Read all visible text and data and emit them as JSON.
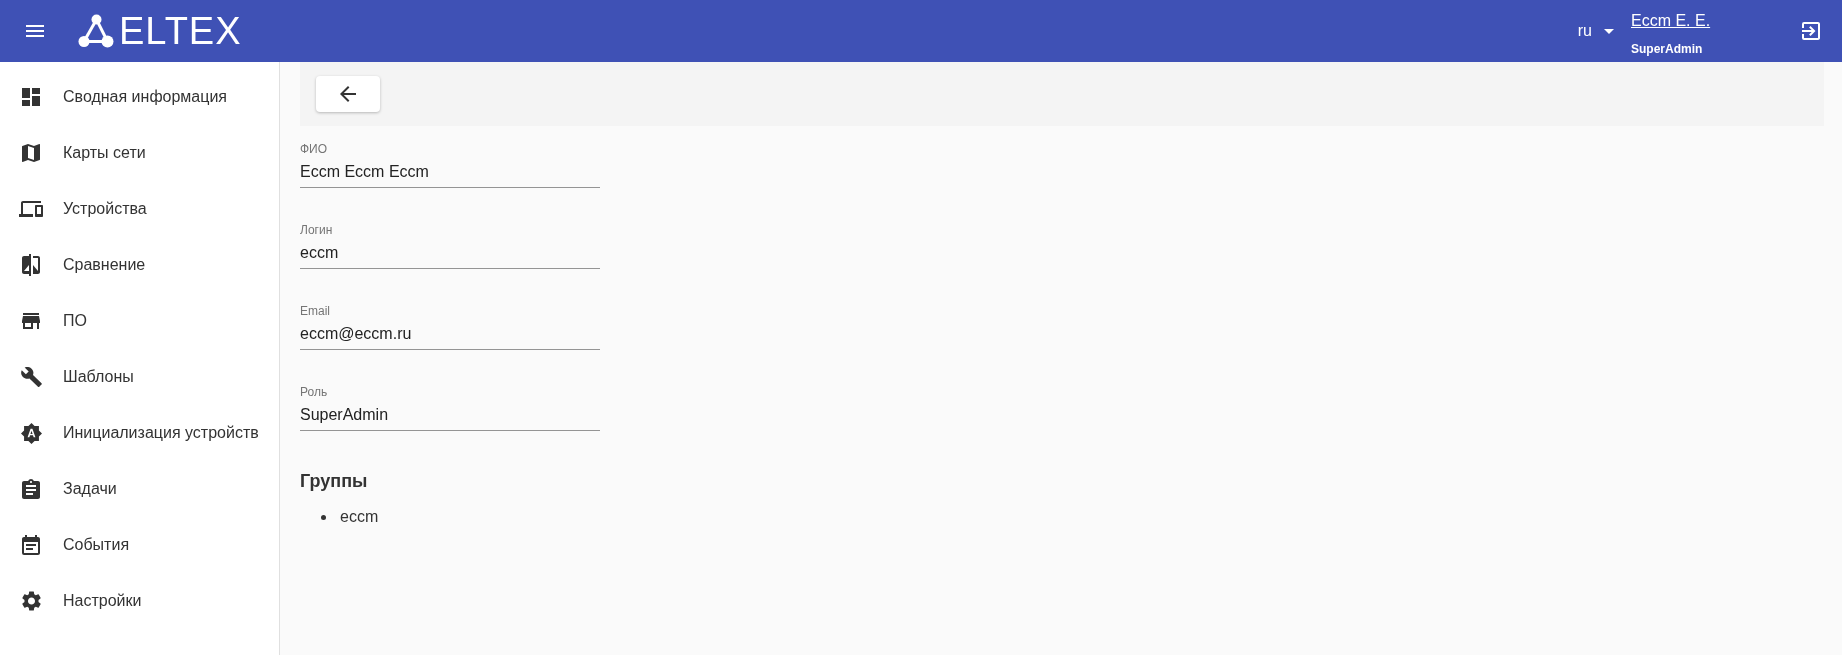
{
  "header": {
    "logo_text": "ELTEX",
    "language": "ru",
    "user": {
      "name": "Eccm E. E.",
      "role": "SuperAdmin"
    }
  },
  "sidebar": {
    "items": [
      "Сводная информация",
      "Карты сети",
      "Устройства",
      "Сравнение",
      "ПО",
      "Шаблоны",
      "Инициализация устройств",
      "Задачи",
      "События",
      "Настройки"
    ]
  },
  "main": {
    "fields": [
      {
        "label": "ФИО",
        "value": "Eccm Eccm Eccm"
      },
      {
        "label": "Логин",
        "value": "eccm"
      },
      {
        "label": "Email",
        "value": "eccm@eccm.ru"
      },
      {
        "label": "Роль",
        "value": "SuperAdmin"
      }
    ],
    "groups": {
      "title": "Группы",
      "items": [
        "eccm"
      ]
    }
  }
}
